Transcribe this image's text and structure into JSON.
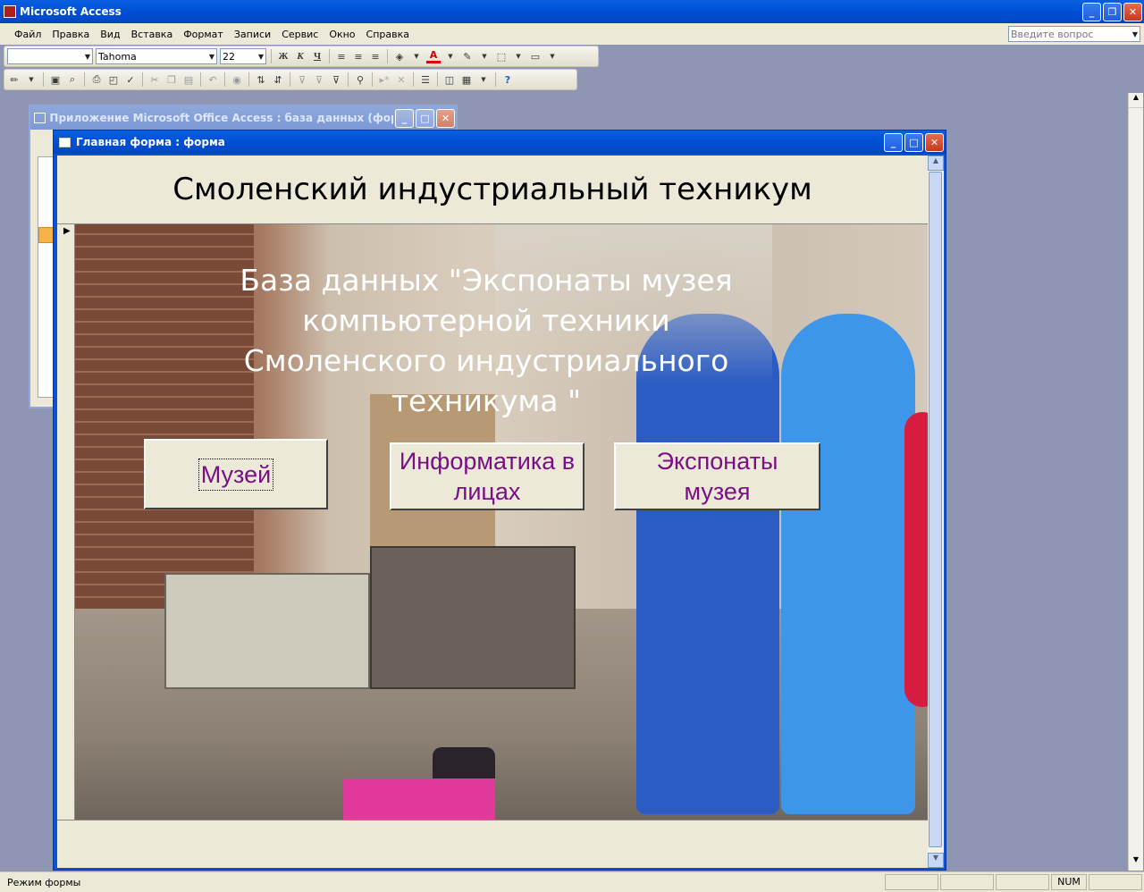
{
  "app": {
    "title": "Microsoft Access"
  },
  "help_search": {
    "placeholder": "Введите вопрос"
  },
  "menu": [
    "Файл",
    "Правка",
    "Вид",
    "Вставка",
    "Формат",
    "Записи",
    "Сервис",
    "Окно",
    "Справка"
  ],
  "format_toolbar": {
    "object_combo": "",
    "font_name": "Tahoma",
    "font_size": "22",
    "bold": "Ж",
    "italic": "К",
    "underline": "Ч",
    "font_color_glyph": "A"
  },
  "db_window": {
    "title": "Приложение Microsoft Office Access : база данных (фор..."
  },
  "form_window": {
    "title": "Главная форма : форма"
  },
  "form": {
    "header_title": "Смоленский индустриальный техникум",
    "db_heading": "База данных \"Экспонаты музея компьютерной техники Смоленского индустриального техникума \"",
    "buttons": {
      "museum": "Музей",
      "informatics": "Информатика в лицах",
      "exhibits": "Экспонаты музея"
    }
  },
  "status": {
    "mode": "Режим формы",
    "num": "NUM"
  },
  "colors": {
    "button_text": "#7a0f86",
    "title_bar": "#0052d6",
    "face": "#ece9d8"
  }
}
